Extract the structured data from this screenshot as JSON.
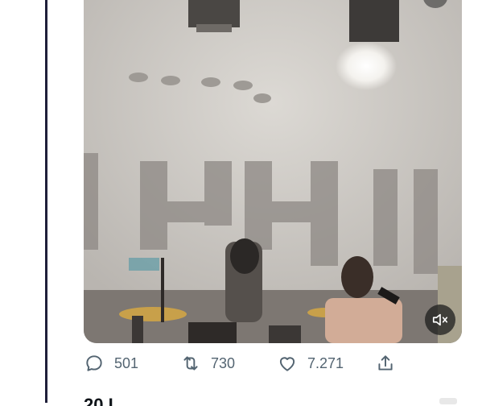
{
  "tweet": {
    "media": {
      "kind": "video",
      "description_icon": "concert-video",
      "mute_icon": "volume-muted-icon"
    },
    "actions": {
      "reply_count": "501",
      "retweet_count": "730",
      "like_count": "7.271"
    }
  },
  "next_tweet": {
    "partial_name": "20 L"
  },
  "colors": {
    "thread_line": "#1f1f3a",
    "action_gray": "#536471"
  }
}
